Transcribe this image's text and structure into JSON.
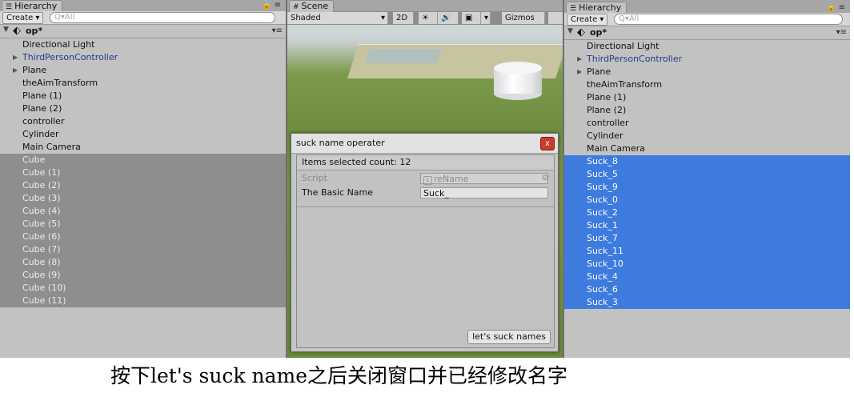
{
  "left_hierarchy": {
    "tab_label": "Hierarchy",
    "tab_tools": "🔒 ≡",
    "create_label": "Create ▾",
    "search_placeholder": "Q▾All",
    "scene_name": "op*",
    "scene_menu": "▾≡",
    "items": [
      {
        "label": "Directional Light"
      },
      {
        "label": "ThirdPersonController"
      },
      {
        "label": "Plane"
      },
      {
        "label": "theAimTransform"
      },
      {
        "label": "Plane (1)"
      },
      {
        "label": "Plane (2)"
      },
      {
        "label": "controller"
      },
      {
        "label": "Cylinder"
      },
      {
        "label": "Main Camera"
      },
      {
        "label": "Cube"
      },
      {
        "label": "Cube (1)"
      },
      {
        "label": "Cube (2)"
      },
      {
        "label": "Cube (3)"
      },
      {
        "label": "Cube (4)"
      },
      {
        "label": "Cube (5)"
      },
      {
        "label": "Cube (6)"
      },
      {
        "label": "Cube (7)"
      },
      {
        "label": "Cube (8)"
      },
      {
        "label": "Cube (9)"
      },
      {
        "label": "Cube (10)"
      },
      {
        "label": "Cube (11)"
      }
    ]
  },
  "scene": {
    "tab_label": "Scene",
    "shading": "Shaded",
    "mode_2d": "2D",
    "light_icon": "☀",
    "audio_icon": "🔊",
    "image_icon": "▣",
    "dropdown": "▾",
    "gizmos": "Gizmos ▾"
  },
  "dialog": {
    "title": "suck name operater",
    "close": "x",
    "items_selected": "Items selected count: 12",
    "script_label": "Script",
    "script_value": "reName",
    "basic_name_label": "The Basic Name",
    "basic_name_value": "Suck_",
    "action_button": "let's suck names"
  },
  "right_hierarchy": {
    "tab_label": "Hierarchy",
    "tab_tools": "🔒 ≡",
    "create_label": "Create ▾",
    "search_placeholder": "Q▾All",
    "scene_name": "op*",
    "scene_menu": "▾≡",
    "items": [
      {
        "label": "Directional Light"
      },
      {
        "label": "ThirdPersonController"
      },
      {
        "label": "Plane"
      },
      {
        "label": "theAimTransform"
      },
      {
        "label": "Plane (1)"
      },
      {
        "label": "Plane (2)"
      },
      {
        "label": "controller"
      },
      {
        "label": "Cylinder"
      },
      {
        "label": "Main Camera"
      },
      {
        "label": "Suck_8"
      },
      {
        "label": "Suck_5"
      },
      {
        "label": "Suck_9"
      },
      {
        "label": "Suck_0"
      },
      {
        "label": "Suck_2"
      },
      {
        "label": "Suck_1"
      },
      {
        "label": "Suck_7"
      },
      {
        "label": "Suck_11"
      },
      {
        "label": "Suck_10"
      },
      {
        "label": "Suck_4"
      },
      {
        "label": "Suck_6"
      },
      {
        "label": "Suck_3"
      }
    ]
  },
  "caption": "按下let's suck name之后关闭窗口并已经修改名字"
}
